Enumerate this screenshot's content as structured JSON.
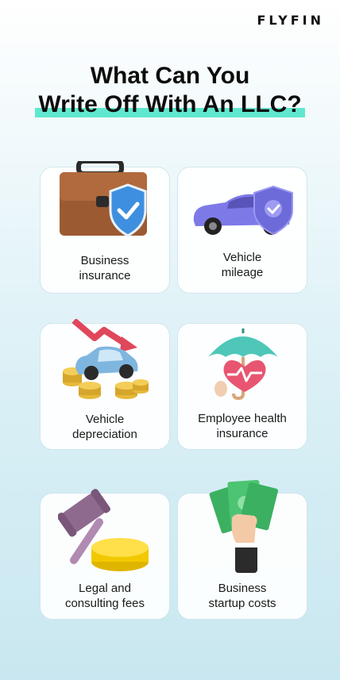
{
  "brand": {
    "name": "FLYFIN"
  },
  "heading": {
    "line1": "What Can You",
    "line2": "Write Off With An LLC?"
  },
  "cards": [
    {
      "label_1": "Business",
      "label_2": "insurance",
      "icon": "briefcase-shield-icon"
    },
    {
      "label_1": "Vehicle",
      "label_2": "mileage",
      "icon": "car-shield-icon"
    },
    {
      "label_1": "Vehicle",
      "label_2": "depreciation",
      "icon": "car-coins-down-arrow-icon"
    },
    {
      "label_1": "Employee health",
      "label_2": "insurance",
      "icon": "umbrella-heart-icon"
    },
    {
      "label_1": "Legal and",
      "label_2": "consulting fees",
      "icon": "gavel-icon"
    },
    {
      "label_1": "Business",
      "label_2": "startup costs",
      "icon": "hand-money-icon"
    }
  ]
}
